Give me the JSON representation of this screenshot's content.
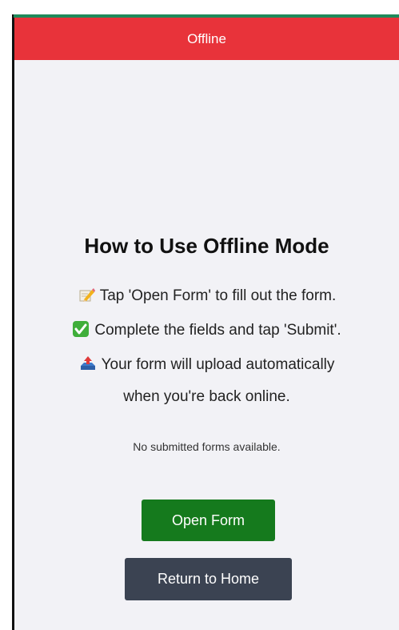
{
  "status_bar": {
    "label": "Offline",
    "color": "#e8333a"
  },
  "guide": {
    "title": "How to Use Offline Mode",
    "steps": [
      {
        "icon": "memo-pencil-icon",
        "text": "Tap 'Open Form' to fill out the form."
      },
      {
        "icon": "check-mark-icon",
        "text": "Complete the fields and tap 'Submit'."
      },
      {
        "icon": "inbox-upload-icon",
        "text": "Your form will upload automatically"
      }
    ],
    "step3_continuation": "when you're back online."
  },
  "submitted": {
    "empty_text": "No submitted forms available."
  },
  "actions": {
    "open_form_label": "Open Form",
    "open_form_color": "#157a1d",
    "return_home_label": "Return to Home",
    "return_home_color": "#3b4352"
  }
}
